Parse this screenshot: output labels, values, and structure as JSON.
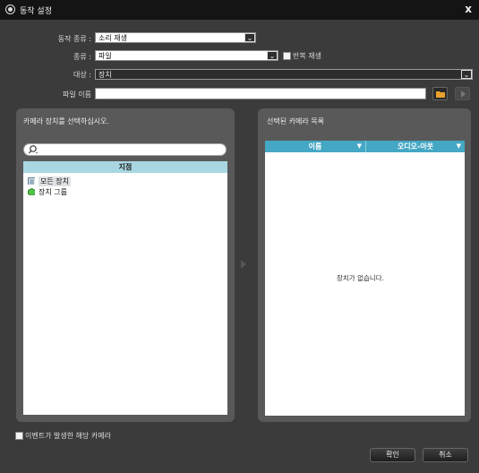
{
  "window": {
    "title": "동작 설정",
    "close_label": "x"
  },
  "form": {
    "action_type_label": "동작 종류 :",
    "action_type_value": "소리 재생",
    "type_label": "종류 :",
    "type_value": "파일",
    "repeat_label": "반복 재생",
    "target_label": "대상 :",
    "target_value": "장치",
    "filename_label": "파일 이름",
    "filename_value": ""
  },
  "left_panel": {
    "title": "카메라 장치를 선택하십시오.",
    "search_placeholder": "",
    "column_header": "지점",
    "tree": [
      {
        "label": "모든 장치",
        "icon": "camera-list-icon"
      },
      {
        "label": "장치 그룹",
        "icon": "cube-group-icon"
      }
    ]
  },
  "right_panel": {
    "title": "선택된 카메라 목록",
    "columns": [
      "이름",
      "오디오-아웃"
    ],
    "empty_message": "장치가 없습니다."
  },
  "footer": {
    "event_camera_label": "이벤트가 발생한 해당 카메라",
    "ok_label": "확인",
    "cancel_label": "취소"
  },
  "colors": {
    "accent": "#44a7c4",
    "header_light": "#a8d7e2",
    "folder": "#e8a12a"
  }
}
